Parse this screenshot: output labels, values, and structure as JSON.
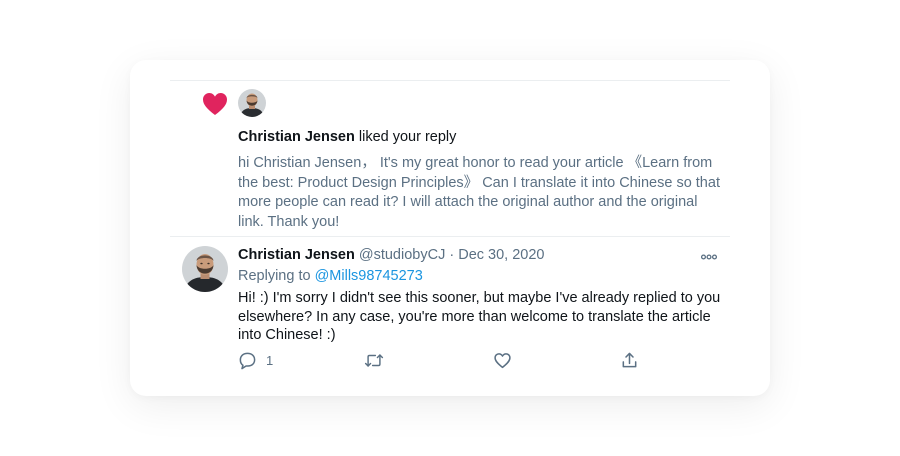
{
  "colors": {
    "heart": "#e0245e",
    "text_primary": "#0f1419",
    "text_secondary": "#5b7083",
    "link": "#1b95e0",
    "divider": "#ebeef0"
  },
  "notification": {
    "icon": "heart-icon",
    "user_name": "Christian Jensen",
    "action_text": " liked your reply",
    "quoted_text": "hi Christian Jensen， It's my great honor to read your article 《Learn from the best: Product Design Principles》 Can I translate it into Chinese so that more people can read it?  I will attach the original author and the original link. Thank you!"
  },
  "tweet": {
    "author_name": "Christian Jensen",
    "handle": "@studiobyCJ",
    "separator": " · ",
    "date": "Dec 30, 2020",
    "replying_prefix": "Replying to ",
    "replying_to": "@Mills98745273",
    "text": "Hi! :) I'm sorry I didn't see this sooner, but maybe I've already replied to you elsewhere? In any case, you're more than welcome to translate the article into Chinese! :)",
    "more_icon": "more-horizontal-icon",
    "actions": {
      "reply": {
        "icon": "reply-icon",
        "count": "1"
      },
      "retweet": {
        "icon": "retweet-icon"
      },
      "like": {
        "icon": "like-icon"
      },
      "share": {
        "icon": "share-icon"
      }
    }
  }
}
